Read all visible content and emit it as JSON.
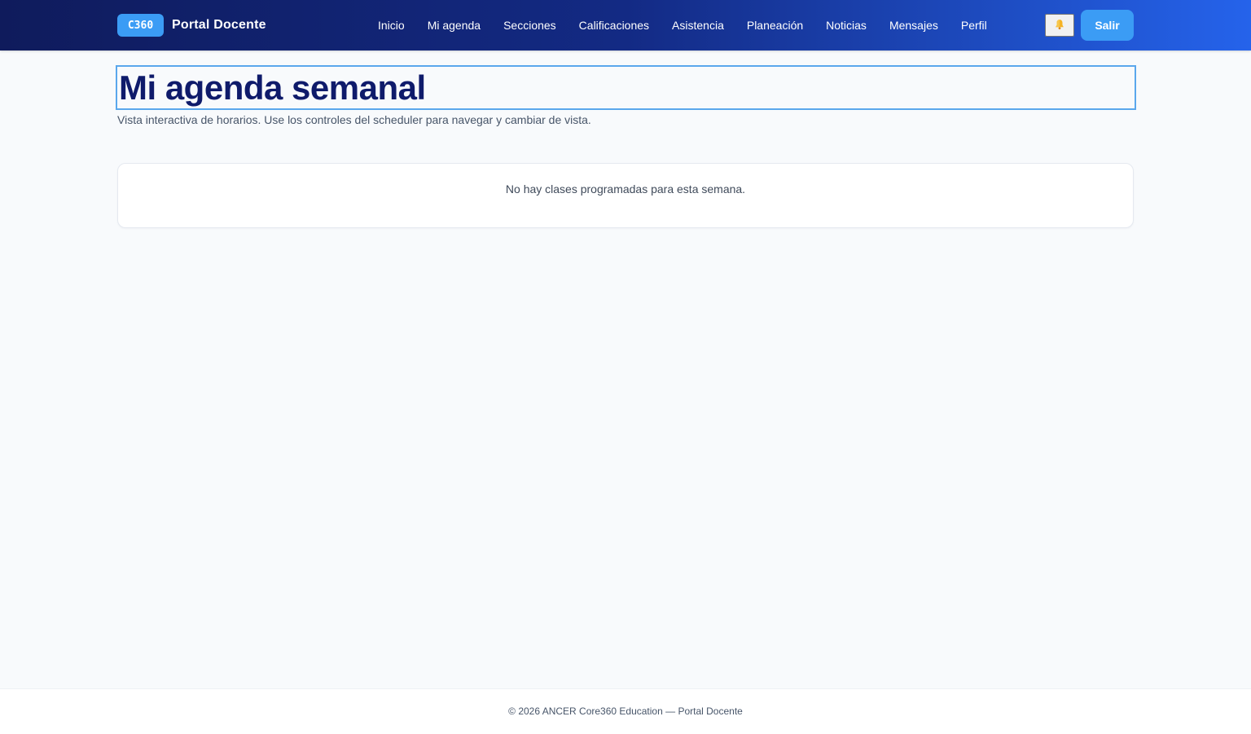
{
  "navbar": {
    "brand_badge": "C360",
    "brand_title": "Portal Docente",
    "links": [
      "Inicio",
      "Mi agenda",
      "Secciones",
      "Calificaciones",
      "Asistencia",
      "Planeación",
      "Noticias",
      "Mensajes",
      "Perfil"
    ],
    "notification_icon": "bell-icon",
    "logout_label": "Salir"
  },
  "page": {
    "title": "Mi agenda semanal",
    "subtitle": "Vista interactiva de horarios. Use los controles del scheduler para navegar y cambiar de vista."
  },
  "schedule": {
    "empty_message": "No hay clases programadas para esta semana."
  },
  "footer": {
    "text": "© 2026 ANCER Core360 Education — Portal Docente"
  },
  "colors": {
    "nav_gradient_start": "#0f1b5c",
    "nav_gradient_end": "#2563eb",
    "accent": "#3b9cf5",
    "title": "#0f1b6b",
    "background": "#f8fafc"
  }
}
